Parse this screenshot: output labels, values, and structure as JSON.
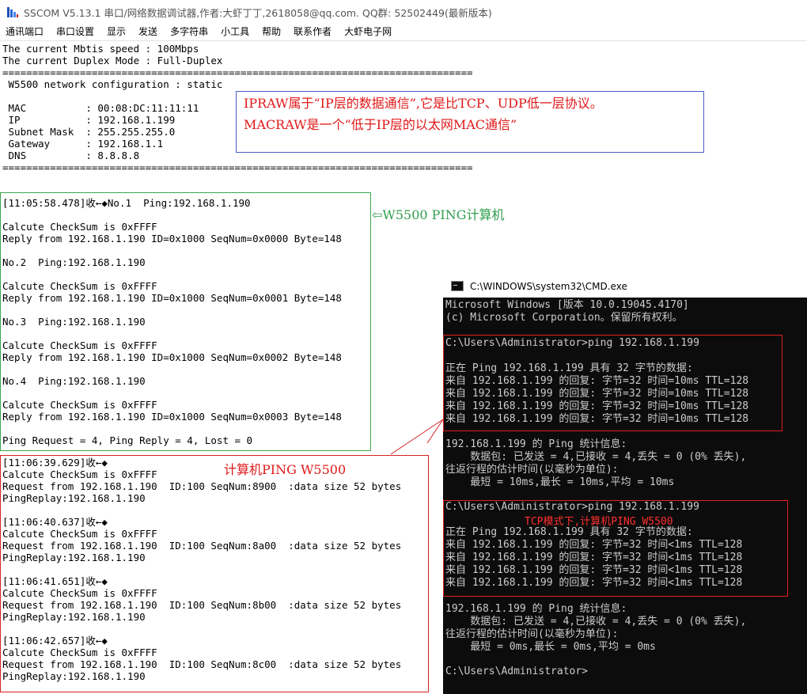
{
  "window": {
    "title": "SSCOM V5.13.1 串口/网络数据调试器,作者:大虾丁丁,2618058@qq.com. QQ群: 52502449(最新版本)",
    "icon": "sscom-app-icon"
  },
  "menu": [
    "通讯端口",
    "串口设置",
    "显示",
    "发送",
    "多字符串",
    "小工具",
    "帮助",
    "联系作者",
    "大虾电子网"
  ],
  "terminal": {
    "header_lines": [
      "The current Mbtis speed : 100Mbps",
      "The current Duplex Mode : Full-Duplex",
      "===============================================================================",
      " W5500 network configuration : static",
      "",
      " MAC          : 00:08:DC:11:11:11",
      " IP           : 192.168.1.199",
      " Subnet Mask  : 255.255.255.0",
      " Gateway      : 192.168.1.1",
      " DNS          : 8.8.8.8",
      "==============================================================================="
    ],
    "ping_out_lines": [
      "[11:05:58.478]收←◆No.1  Ping:192.168.1.190",
      "",
      "Calcute CheckSum is 0xFFFF",
      "Reply from 192.168.1.190 ID=0x1000 SeqNum=0x0000 Byte=148",
      "",
      "No.2  Ping:192.168.1.190",
      "",
      "Calcute CheckSum is 0xFFFF",
      "Reply from 192.168.1.190 ID=0x1000 SeqNum=0x0001 Byte=148",
      "",
      "No.3  Ping:192.168.1.190",
      "",
      "Calcute CheckSum is 0xFFFF",
      "Reply from 192.168.1.190 ID=0x1000 SeqNum=0x0002 Byte=148",
      "",
      "No.4  Ping:192.168.1.190",
      "",
      "Calcute CheckSum is 0xFFFF",
      "Reply from 192.168.1.190 ID=0x1000 SeqNum=0x0003 Byte=148",
      "",
      "Ping Request = 4, Ping Reply = 4, Lost = 0"
    ],
    "ping_in_lines": [
      "[11:06:39.629]收←◆",
      "Calcute CheckSum is 0xFFFF",
      "Request from 192.168.1.190  ID:100 SeqNum:8900  :data size 52 bytes",
      "PingReplay:192.168.1.190",
      "",
      "[11:06:40.637]收←◆",
      "Calcute CheckSum is 0xFFFF",
      "Request from 192.168.1.190  ID:100 SeqNum:8a00  :data size 52 bytes",
      "PingReplay:192.168.1.190",
      "",
      "[11:06:41.651]收←◆",
      "Calcute CheckSum is 0xFFFF",
      "Request from 192.168.1.190  ID:100 SeqNum:8b00  :data size 52 bytes",
      "PingReplay:192.168.1.190",
      "",
      "[11:06:42.657]收←◆",
      "Calcute CheckSum is 0xFFFF",
      "Request from 192.168.1.190  ID:100 SeqNum:8c00  :data size 52 bytes",
      "PingReplay:192.168.1.190"
    ]
  },
  "annotations": {
    "ipraw_note_line1": "IPRAW属于“IP层的数据通信”,它是比TCP、UDP低一层协议。",
    "ipraw_note_line2": "MACRAW是一个“低于IP层的以太网MAC通信”",
    "w5500_ping_label": "⇦W5500 PING计算机",
    "pc_ping_label": "计算机PING W5500",
    "tcp_mode_label": "TCP模式下,计算机PING W5500"
  },
  "cmd": {
    "title": "C:\\WINDOWS\\system32\\CMD.exe",
    "lines_top": [
      "Microsoft Windows [版本 10.0.19045.4170]",
      "(c) Microsoft Corporation。保留所有权利。"
    ],
    "session1": [
      "C:\\Users\\Administrator>ping 192.168.1.199",
      "",
      "正在 Ping 192.168.1.199 具有 32 字节的数据:",
      "来自 192.168.1.199 的回复: 字节=32 时间=10ms TTL=128",
      "来自 192.168.1.199 的回复: 字节=32 时间=10ms TTL=128",
      "来自 192.168.1.199 的回复: 字节=32 时间=10ms TTL=128",
      "来自 192.168.1.199 的回复: 字节=32 时间=10ms TTL=128"
    ],
    "stats1": [
      "192.168.1.199 的 Ping 统计信息:",
      "    数据包: 已发送 = 4,已接收 = 4,丢失 = 0 (0% 丢失),",
      "往返行程的估计时间(以毫秒为单位):",
      "    最短 = 10ms,最长 = 10ms,平均 = 10ms"
    ],
    "session2_prompt": "C:\\Users\\Administrator>ping 192.168.1.199",
    "session2": [
      "正在 Ping 192.168.1.199 具有 32 字节的数据:",
      "来自 192.168.1.199 的回复: 字节=32 时间<1ms TTL=128",
      "来自 192.168.1.199 的回复: 字节=32 时间<1ms TTL=128",
      "来自 192.168.1.199 的回复: 字节=32 时间<1ms TTL=128",
      "来自 192.168.1.199 的回复: 字节=32 时间<1ms TTL=128"
    ],
    "stats2": [
      "192.168.1.199 的 Ping 统计信息:",
      "    数据包: 已发送 = 4,已接收 = 4,丢失 = 0 (0% 丢失),",
      "往返行程的估计时间(以毫秒为单位):",
      "    最短 = 0ms,最长 = 0ms,平均 = 0ms"
    ],
    "final_prompt": "C:\\Users\\Administrator>"
  },
  "colors": {
    "green_box": "#3aa552",
    "red_box": "#d82222",
    "blue_box": "#4a5ec7",
    "cmd_bg": "#0c0c0c",
    "cmd_text": "#cccccc"
  }
}
